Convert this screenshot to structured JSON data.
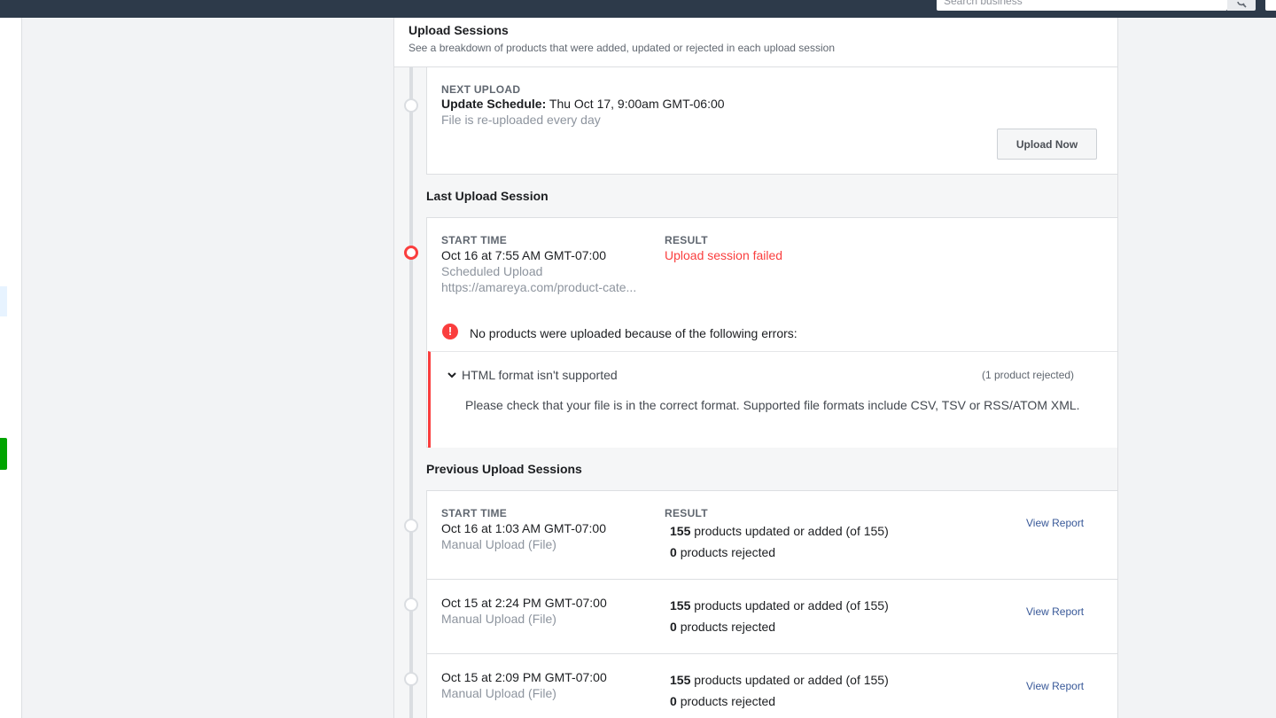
{
  "topbar": {
    "search_placeholder": "Search business",
    "search_icon": "search-icon"
  },
  "panel": {
    "title": "Upload Sessions",
    "subtitle": "See a breakdown of products that were added, updated or rejected in each upload session"
  },
  "next_upload": {
    "label": "NEXT UPLOAD",
    "schedule_label": "Update Schedule:",
    "schedule_value": "Thu Oct 17, 9:00am GMT-06:00",
    "frequency": "File is re-uploaded every day",
    "button_label": "Upload Now"
  },
  "last_session": {
    "section_title": "Last Upload Session",
    "start_time_label": "START TIME",
    "start_time": "Oct 16 at 7:55 AM GMT-07:00",
    "upload_type": "Scheduled Upload",
    "source_url": "https://amareya.com/product-cate...",
    "result_label": "RESULT",
    "result": "Upload session failed",
    "error_icon": "error-icon",
    "error_summary": "No products were uploaded because of the following errors:",
    "error": {
      "chevron_icon": "chevron-down-icon",
      "title": "HTML format isn't supported",
      "count": "(1 product rejected)",
      "detail": "Please check that your file is in the correct format. Supported file formats include CSV, TSV or RSS/ATOM XML."
    }
  },
  "previous_sessions": {
    "section_title": "Previous Upload Sessions",
    "start_time_label": "START TIME",
    "result_label": "RESULT",
    "rows": [
      {
        "start_time": "Oct 16 at 1:03 AM GMT-07:00",
        "upload_type": "Manual Upload (File)",
        "updated_count": "155",
        "updated_text": "products updated or added (of 155)",
        "rejected_count": "0",
        "rejected_text": "products rejected",
        "link_label": "View Report"
      },
      {
        "start_time": "Oct 15 at 2:24 PM GMT-07:00",
        "upload_type": "Manual Upload (File)",
        "updated_count": "155",
        "updated_text": "products updated or added (of 155)",
        "rejected_count": "0",
        "rejected_text": "products rejected",
        "link_label": "View Report"
      },
      {
        "start_time": "Oct 15 at 2:09 PM GMT-07:00",
        "upload_type": "Manual Upload (File)",
        "updated_count": "155",
        "updated_text": "products updated or added (of 155)",
        "rejected_count": "0",
        "rejected_text": "products rejected",
        "link_label": "View Report"
      }
    ]
  },
  "colors": {
    "error": "#fa3e3e",
    "link": "#385898",
    "topbar": "#2d3a4a"
  }
}
